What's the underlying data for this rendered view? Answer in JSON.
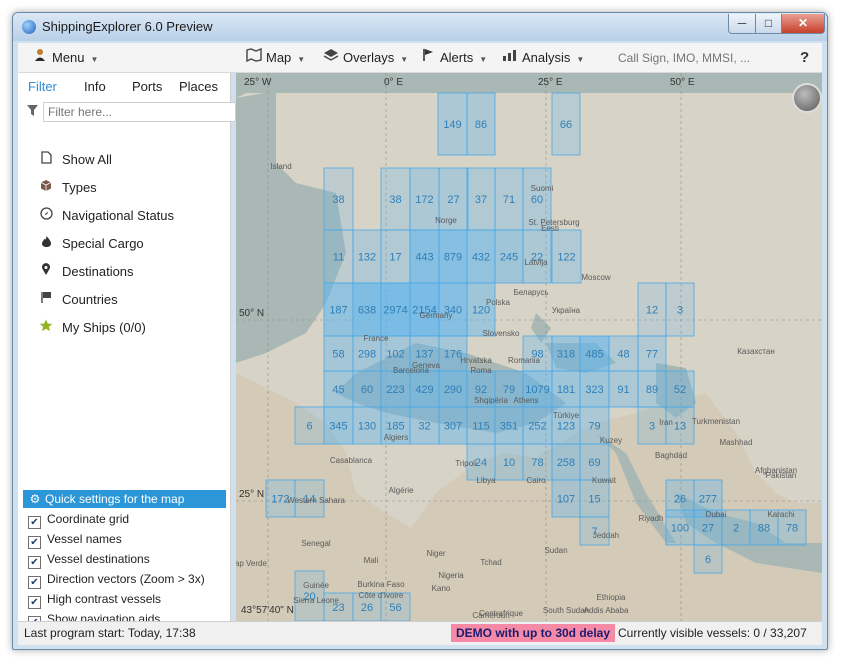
{
  "window": {
    "title": "ShippingExplorer 6.0 Preview",
    "min_glyph": "─",
    "max_glyph": "□",
    "close_glyph": "✕"
  },
  "toolbar": {
    "menu_label": "Menu",
    "map_label": "Map",
    "overlays_label": "Overlays",
    "alerts_label": "Alerts",
    "analysis_label": "Analysis",
    "search_placeholder": "Call Sign, IMO, MMSI, ...",
    "help_label": "?"
  },
  "sidebar": {
    "tabs": [
      {
        "label": "Filter",
        "active": true
      },
      {
        "label": "Info",
        "active": false
      },
      {
        "label": "Ports",
        "active": false
      },
      {
        "label": "Places",
        "active": false
      }
    ],
    "filter_placeholder": "Filter here...",
    "items": [
      {
        "label": "Show All",
        "icon": "document-icon"
      },
      {
        "label": "Types",
        "icon": "cube-icon"
      },
      {
        "label": "Navigational Status",
        "icon": "compass-icon"
      },
      {
        "label": "Special Cargo",
        "icon": "flame-icon"
      },
      {
        "label": "Destinations",
        "icon": "location-pin-icon"
      },
      {
        "label": "Countries",
        "icon": "flag-icon"
      },
      {
        "label": "My Ships (0/0)",
        "icon": "star-icon"
      }
    ],
    "quick_settings_title": "Quick settings for the map",
    "quick_settings": [
      {
        "label": "Coordinate grid",
        "checked": true
      },
      {
        "label": "Vessel names",
        "checked": true
      },
      {
        "label": "Vessel destinations",
        "checked": true
      },
      {
        "label": "Direction vectors (Zoom > 3x)",
        "checked": true
      },
      {
        "label": "High contrast vessels",
        "checked": true
      },
      {
        "label": "Show navigation aids",
        "checked": true
      }
    ]
  },
  "map": {
    "grid_labels": {
      "lon_25w": "25° W",
      "lon_0e": "0° E",
      "lon_25e": "25° E",
      "lon_50e": "50° E",
      "lat_50n": "50° N",
      "lat_25n": "25° N"
    },
    "cursor_coordinate": "43°57'40\" N",
    "vessel_counts": [
      {
        "label": "149",
        "level": 0.35
      },
      {
        "label": "86",
        "level": 0.35
      },
      {
        "label": "66",
        "level": 0.25
      },
      {
        "label": "38",
        "level": 0.2
      },
      {
        "label": "38",
        "level": 0.25
      },
      {
        "label": "172",
        "level": 0.35
      },
      {
        "label": "27",
        "level": 0.35
      },
      {
        "label": "37",
        "level": 0.3
      },
      {
        "label": "71",
        "level": 0.3
      },
      {
        "label": "60",
        "level": 0.3
      },
      {
        "label": "11",
        "level": 0.2
      },
      {
        "label": "132",
        "level": 0.3
      },
      {
        "label": "17",
        "level": 0.3
      },
      {
        "label": "443",
        "level": 0.65
      },
      {
        "label": "879",
        "level": 0.65
      },
      {
        "label": "432",
        "level": 0.55
      },
      {
        "label": "245",
        "level": 0.45
      },
      {
        "label": "22",
        "level": 0.35
      },
      {
        "label": "122",
        "level": 0.3
      },
      {
        "label": "187",
        "level": 0.55
      },
      {
        "label": "638",
        "level": 0.7
      },
      {
        "label": "2974",
        "level": 0.75
      },
      {
        "label": "2154",
        "level": 0.75
      },
      {
        "label": "340",
        "level": 0.65
      },
      {
        "label": "120",
        "level": 0.45
      },
      {
        "label": "12",
        "level": 0.2
      },
      {
        "label": "3",
        "level": 0.2
      },
      {
        "label": "58",
        "level": 0.4
      },
      {
        "label": "298",
        "level": 0.4
      },
      {
        "label": "102",
        "level": 0.4
      },
      {
        "label": "137",
        "level": 0.4
      },
      {
        "label": "176",
        "level": 0.4
      },
      {
        "label": "98",
        "level": 0.3
      },
      {
        "label": "318",
        "level": 0.45
      },
      {
        "label": "485",
        "level": 0.6
      },
      {
        "label": "48",
        "level": 0.3
      },
      {
        "label": "77",
        "level": 0.3
      },
      {
        "label": "45",
        "level": 0.4
      },
      {
        "label": "60",
        "level": 0.4
      },
      {
        "label": "223",
        "level": 0.5
      },
      {
        "label": "429",
        "level": 0.55
      },
      {
        "label": "290",
        "level": 0.55
      },
      {
        "label": "92",
        "level": 0.45
      },
      {
        "label": "79",
        "level": 0.4
      },
      {
        "label": "1079",
        "level": 0.55
      },
      {
        "label": "181",
        "level": 0.45
      },
      {
        "label": "323",
        "level": 0.45
      },
      {
        "label": "91",
        "level": 0.35
      },
      {
        "label": "89",
        "level": 0.35
      },
      {
        "label": "52",
        "level": 0.3
      },
      {
        "label": "6",
        "level": 0.2
      },
      {
        "label": "345",
        "level": 0.45
      },
      {
        "label": "130",
        "level": 0.4
      },
      {
        "label": "185",
        "level": 0.45
      },
      {
        "label": "32",
        "level": 0.4
      },
      {
        "label": "307",
        "level": 0.45
      },
      {
        "label": "115",
        "level": 0.4
      },
      {
        "label": "351",
        "level": 0.45
      },
      {
        "label": "252",
        "level": 0.45
      },
      {
        "label": "123",
        "level": 0.4
      },
      {
        "label": "79",
        "level": 0.35
      },
      {
        "label": "3",
        "level": 0.2
      },
      {
        "label": "13",
        "level": 0.25
      },
      {
        "label": "24",
        "level": 0.3
      },
      {
        "label": "10",
        "level": 0.3
      },
      {
        "label": "78",
        "level": 0.3
      },
      {
        "label": "258",
        "level": 0.4
      },
      {
        "label": "69",
        "level": 0.35
      },
      {
        "label": "172",
        "level": 0.25
      },
      {
        "label": "14",
        "level": 0.2
      },
      {
        "label": "107",
        "level": 0.35
      },
      {
        "label": "15",
        "level": 0.3
      },
      {
        "label": "26",
        "level": 0.3
      },
      {
        "label": "277",
        "level": 0.35
      },
      {
        "label": "7",
        "level": 0.2
      },
      {
        "label": "100",
        "level": 0.3
      },
      {
        "label": "27",
        "level": 0.3
      },
      {
        "label": "2",
        "level": 0.2
      },
      {
        "label": "88",
        "level": 0.3
      },
      {
        "label": "78",
        "level": 0.3
      },
      {
        "label": "6",
        "level": 0.2
      },
      {
        "label": "20",
        "level": 0.2
      },
      {
        "label": "23",
        "level": 0.2
      },
      {
        "label": "26",
        "level": 0.2
      },
      {
        "label": "56",
        "level": 0.2
      }
    ],
    "place_labels": [
      "Island",
      "Norge",
      "Suomi",
      "Eesti",
      "St. Petersburg",
      "Latvija",
      "Moscow",
      "Беларусь",
      "Polska",
      "Slovensko",
      "Romania",
      "Україна",
      "Казахстан",
      "Germany",
      "France",
      "Geneva",
      "Hrvatska",
      "Shqipëria",
      "Türkiye",
      "Turkmenistan",
      "Mashhad",
      "Afghanistan",
      "Pakistan",
      "Iran",
      "Baghdad",
      "Kuwait",
      "Riyadh",
      "Dubai",
      "Karachi",
      "Casablanca",
      "Algérie",
      "Libya",
      "Tripoli",
      "Cairo",
      "Jeddah",
      "Mali",
      "Niger",
      "Tchad",
      "Sudan",
      "Ethiopia",
      "Addis Ababa",
      "Senegal",
      "Guinée",
      "Burkina Faso",
      "Nigeria",
      "Kano",
      "Côte d'Ivoire",
      "Centrafrique",
      "South Sudan",
      "Cameroun",
      "Sierra Leone",
      "Western Sahara",
      "Algiers",
      "Barcelona",
      "Roma",
      "Athens",
      "Kuzey",
      "Cap Verde"
    ]
  },
  "status": {
    "last_start": "Last program start: Today, 17:38",
    "demo": "DEMO with up to 30d delay",
    "visible_vessels": "Currently visible vessels: 0 / 33,207"
  }
}
